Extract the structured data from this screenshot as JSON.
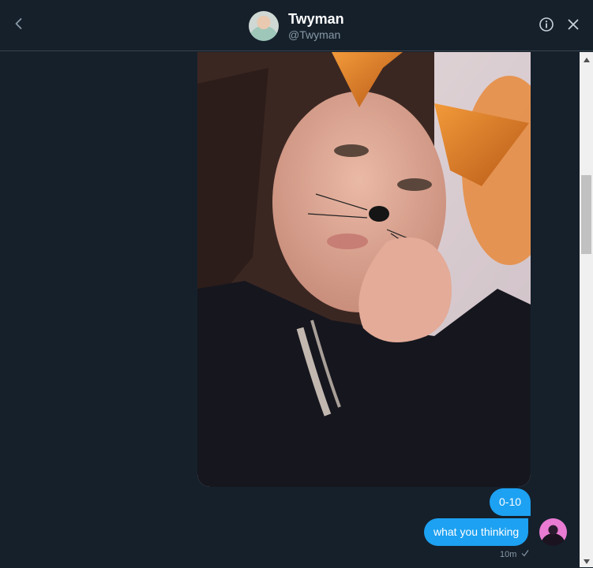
{
  "header": {
    "name": "Twyman",
    "handle": "@Twyman",
    "back_icon": "chevron-left-icon",
    "info_icon": "info-icon",
    "close_icon": "close-icon"
  },
  "conversation": {
    "messages": [
      {
        "type": "image",
        "from": "me",
        "description_icon": "photo"
      },
      {
        "type": "text",
        "from": "me",
        "text": "0-10"
      },
      {
        "type": "text",
        "from": "me",
        "text": "what you thinking"
      }
    ],
    "last_timestamp": "10m",
    "read_status_icon": "check-icon"
  },
  "colors": {
    "background": "#15202b",
    "bubble": "#1da1f2",
    "muted_text": "#8899a6",
    "divider": "#38444d"
  }
}
